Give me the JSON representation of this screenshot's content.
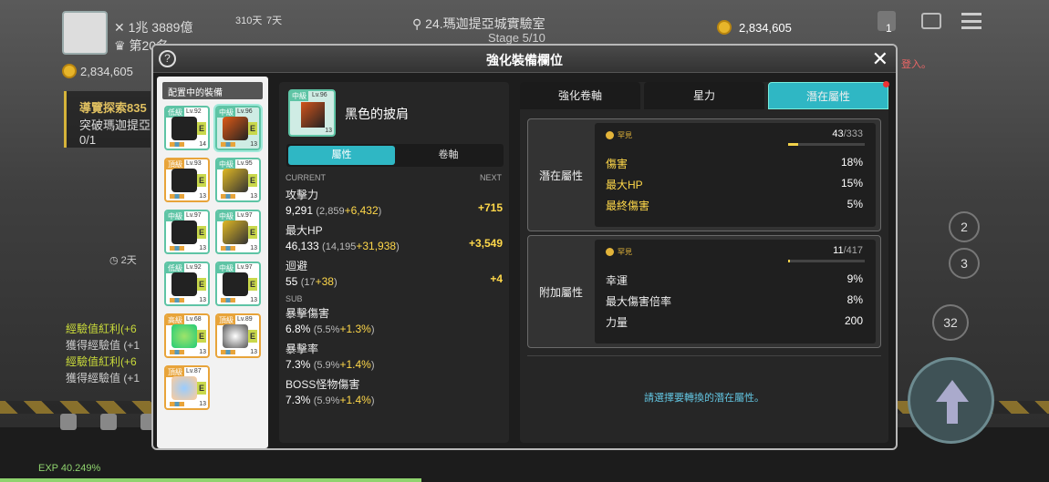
{
  "hud": {
    "combat_power": "1兆 3889億",
    "rank": "第20名",
    "days1": "310天",
    "days2": "7天",
    "location": "24.瑪迦提亞城實驗室",
    "stage": "Stage 5/10",
    "meso": "2,834,605",
    "bag_count": "1",
    "meso_left": "2,834,605",
    "quest_title": "導覽探索835",
    "quest_desc": "突破瑪迦提亞",
    "quest_progress": "0/1",
    "timer": "2天",
    "chat": [
      "經驗值紅利(+6",
      "獲得經驗值 (+1",
      "經驗值紅利(+6",
      "獲得經驗值 (+1"
    ],
    "login_hint": "登入。",
    "btn_2": "2",
    "btn_3": "3",
    "btn_32": "32",
    "exp": "EXP 40.249%"
  },
  "modal": {
    "title": "強化裝備欄位",
    "help": "?",
    "close": "✕",
    "equipped_title": "配置中的裝備",
    "slots": [
      {
        "tier": "低級",
        "lv": "Lv.92",
        "num": "14"
      },
      {
        "tier": "中級",
        "lv": "Lv.96",
        "num": "13"
      },
      {
        "tier": "頂級",
        "lv": "Lv.93",
        "num": "13"
      },
      {
        "tier": "中級",
        "lv": "Lv.95",
        "num": "13"
      },
      {
        "tier": "中級",
        "lv": "Lv.97",
        "num": "13"
      },
      {
        "tier": "中級",
        "lv": "Lv.97",
        "num": "13"
      },
      {
        "tier": "低級",
        "lv": "Lv.92",
        "num": "13"
      },
      {
        "tier": "中級",
        "lv": "Lv.97",
        "num": "13"
      },
      {
        "tier": "高級",
        "lv": "Lv.68",
        "num": "13"
      },
      {
        "tier": "頂級",
        "lv": "Lv.89",
        "num": "13"
      },
      {
        "tier": "頂級",
        "lv": "Lv.87",
        "num": "13"
      }
    ],
    "item": {
      "tier": "中級",
      "lv": "Lv.96",
      "num": "13",
      "name": "黑色的披肩",
      "tab_attr": "屬性",
      "tab_scroll": "卷軸",
      "current_label": "CURRENT",
      "next_label": "NEXT",
      "sub_label": "SUB",
      "stats": [
        {
          "name": "攻擊力",
          "value": "9,291",
          "base": "(2,859",
          "bonus": "+6,432",
          "close": ")",
          "next": "+715"
        },
        {
          "name": "最大HP",
          "value": "46,133",
          "base": "(14,195",
          "bonus": "+31,938",
          "close": ")",
          "next": "+3,549"
        },
        {
          "name": "迴避",
          "value": "55",
          "base": "(17",
          "bonus": "+38",
          "close": ")",
          "next": "+4"
        }
      ],
      "sub_stats": [
        {
          "name": "暴擊傷害",
          "value": "6.8%",
          "base": "(5.5%",
          "bonus": "+1.3%",
          "close": ")"
        },
        {
          "name": "暴擊率",
          "value": "7.3%",
          "base": "(5.9%",
          "bonus": "+1.4%",
          "close": ")"
        },
        {
          "name": "BOSS怪物傷害",
          "value": "7.3%",
          "base": "(5.9%",
          "bonus": "+1.4%",
          "close": ")"
        }
      ]
    },
    "tabs": [
      "強化卷軸",
      "星力",
      "潛在屬性"
    ],
    "potential": {
      "label": "潛在屬性",
      "rarity": "罕見",
      "count": "43",
      "max": "/333",
      "progress": 0.13,
      "rows": [
        {
          "name": "傷害",
          "value": "18%"
        },
        {
          "name": "最大HP",
          "value": "15%"
        },
        {
          "name": "最終傷害",
          "value": "5%"
        }
      ]
    },
    "additional": {
      "label": "附加屬性",
      "rarity": "罕見",
      "count": "11",
      "max": "/417",
      "progress": 0.026,
      "rows": [
        {
          "name": "幸運",
          "value": "9%"
        },
        {
          "name": "最大傷害倍率",
          "value": "8%"
        },
        {
          "name": "力量",
          "value": "200"
        }
      ]
    },
    "hint": "請選擇要轉換的潛在屬性。"
  }
}
